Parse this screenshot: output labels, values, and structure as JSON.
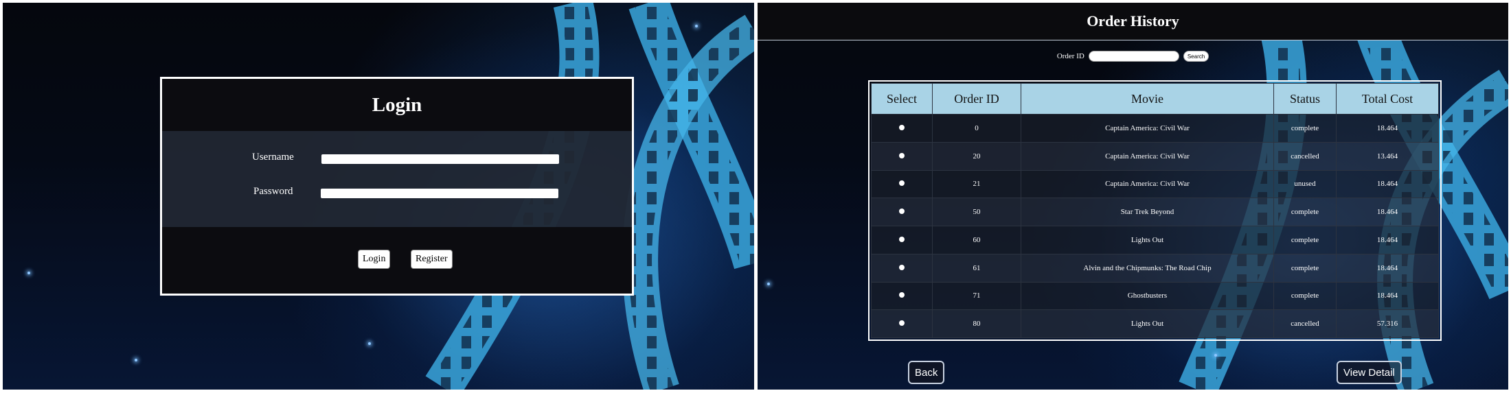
{
  "login": {
    "title": "Login",
    "username_label": "Username",
    "username_value": "",
    "password_label": "Password",
    "password_value": "",
    "login_button": "Login",
    "register_button": "Register"
  },
  "order_history": {
    "title": "Order History",
    "search_label": "Order ID",
    "search_value": "",
    "search_button": "Search",
    "columns": [
      "Select",
      "Order ID",
      "Movie",
      "Status",
      "Total Cost"
    ],
    "rows": [
      {
        "order_id": "0",
        "movie": "Captain America: Civil War",
        "status": "complete",
        "total_cost": "18.464"
      },
      {
        "order_id": "20",
        "movie": "Captain America: Civil War",
        "status": "cancelled",
        "total_cost": "13.464"
      },
      {
        "order_id": "21",
        "movie": "Captain America: Civil War",
        "status": "unused",
        "total_cost": "18.464"
      },
      {
        "order_id": "50",
        "movie": "Star Trek Beyond",
        "status": "complete",
        "total_cost": "18.464"
      },
      {
        "order_id": "60",
        "movie": "Lights Out",
        "status": "complete",
        "total_cost": "18.464"
      },
      {
        "order_id": "61",
        "movie": "Alvin and the Chipmunks: The Road Chip",
        "status": "complete",
        "total_cost": "18.464"
      },
      {
        "order_id": "71",
        "movie": "Ghostbusters",
        "status": "complete",
        "total_cost": "18.464"
      },
      {
        "order_id": "80",
        "movie": "Lights Out",
        "status": "cancelled",
        "total_cost": "57.316"
      }
    ],
    "back_button": "Back",
    "view_detail_button": "View Detail"
  },
  "colors": {
    "table_header": "#a9d3e6",
    "film_strip": "#3aa6dc",
    "background_dark": "#05070d"
  }
}
